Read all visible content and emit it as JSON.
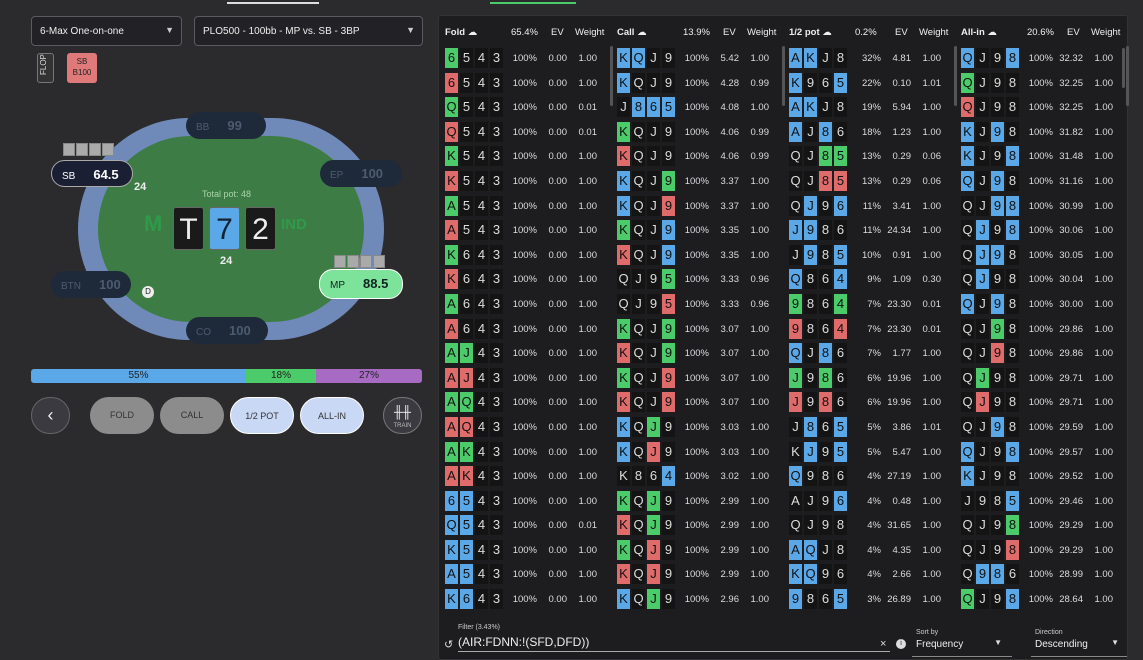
{
  "selectors": {
    "game": "6-Max One-on-one",
    "spot": "PLO500 - 100bb - MP vs. SB - 3BP"
  },
  "street": "FLOP",
  "history": {
    "line1": "SB",
    "line2": "B100"
  },
  "table": {
    "total_pot": "Total pot: 48",
    "board": [
      "T",
      "7",
      "2"
    ],
    "bet_sb": "24",
    "bet_mp": "24",
    "dealer": "D",
    "logo": "IND",
    "seats": [
      {
        "name": "BB",
        "stack": "99"
      },
      {
        "name": "SB",
        "stack": "64.5"
      },
      {
        "name": "EP",
        "stack": "100"
      },
      {
        "name": "BTN",
        "stack": "100"
      },
      {
        "name": "MP",
        "stack": "88.5"
      },
      {
        "name": "CO",
        "stack": "100"
      }
    ]
  },
  "strategy_bar": [
    {
      "label": "55%",
      "fraction": 0.55,
      "color": "#5aa8e8"
    },
    {
      "label": "18%",
      "fraction": 0.18,
      "color": "#4ccb6a"
    },
    {
      "label": "27%",
      "fraction": 0.27,
      "color": "#a76bc4"
    }
  ],
  "actions": {
    "back": "‹",
    "fold": "FOLD",
    "call": "CALL",
    "half": "1/2 POT",
    "allin": "ALL-IN",
    "train": "TRAIN"
  },
  "columns": [
    {
      "title": "Fold",
      "freq": "65.4%",
      "ev": "EV",
      "weight": "Weight",
      "rows": [
        [
          "g6 k5 k4 k3",
          "100%",
          "0.00",
          "1.00"
        ],
        [
          "r6 k5 k4 k3",
          "100%",
          "0.00",
          "1.00"
        ],
        [
          "gQ k5 k4 k3",
          "100%",
          "0.00",
          "0.01"
        ],
        [
          "rQ k5 k4 k3",
          "100%",
          "0.00",
          "0.01"
        ],
        [
          "gK k5 k4 k3",
          "100%",
          "0.00",
          "1.00"
        ],
        [
          "rK k5 k4 k3",
          "100%",
          "0.00",
          "1.00"
        ],
        [
          "gA k5 k4 k3",
          "100%",
          "0.00",
          "1.00"
        ],
        [
          "rA k5 k4 k3",
          "100%",
          "0.00",
          "1.00"
        ],
        [
          "gK k6 k4 k3",
          "100%",
          "0.00",
          "1.00"
        ],
        [
          "rK k6 k4 k3",
          "100%",
          "0.00",
          "1.00"
        ],
        [
          "gA k6 k4 k3",
          "100%",
          "0.00",
          "1.00"
        ],
        [
          "rA k6 k4 k3",
          "100%",
          "0.00",
          "1.00"
        ],
        [
          "gA gJ k4 k3",
          "100%",
          "0.00",
          "1.00"
        ],
        [
          "rA rJ k4 k3",
          "100%",
          "0.00",
          "1.00"
        ],
        [
          "gA gQ k4 k3",
          "100%",
          "0.00",
          "1.00"
        ],
        [
          "rA rQ k4 k3",
          "100%",
          "0.00",
          "1.00"
        ],
        [
          "gA gK k4 k3",
          "100%",
          "0.00",
          "1.00"
        ],
        [
          "rA rK k4 k3",
          "100%",
          "0.00",
          "1.00"
        ],
        [
          "b6 b5 k4 k3",
          "100%",
          "0.00",
          "1.00"
        ],
        [
          "bQ b5 k4 k3",
          "100%",
          "0.00",
          "0.01"
        ],
        [
          "bK b5 k4 k3",
          "100%",
          "0.00",
          "1.00"
        ],
        [
          "bA b5 k4 k3",
          "100%",
          "0.00",
          "1.00"
        ],
        [
          "bK b6 k4 k3",
          "100%",
          "0.00",
          "1.00"
        ]
      ]
    },
    {
      "title": "Call",
      "freq": "13.9%",
      "ev": "EV",
      "weight": "Weight",
      "rows": [
        [
          "bK bQ kJ k9",
          "100%",
          "5.42",
          "1.00"
        ],
        [
          "bK kQ kJ k9",
          "100%",
          "4.28",
          "0.99"
        ],
        [
          "kJ b8 b6 b5",
          "100%",
          "4.08",
          "1.00"
        ],
        [
          "gK kQ kJ k9",
          "100%",
          "4.06",
          "0.99"
        ],
        [
          "rK kQ kJ k9",
          "100%",
          "4.06",
          "0.99"
        ],
        [
          "bK kQ kJ g9",
          "100%",
          "3.37",
          "1.00"
        ],
        [
          "bK kQ kJ r9",
          "100%",
          "3.37",
          "1.00"
        ],
        [
          "gK kQ kJ b9",
          "100%",
          "3.35",
          "1.00"
        ],
        [
          "rK kQ kJ b9",
          "100%",
          "3.35",
          "1.00"
        ],
        [
          "kQ kJ k9 g5",
          "100%",
          "3.33",
          "0.96"
        ],
        [
          "kQ kJ k9 r5",
          "100%",
          "3.33",
          "0.96"
        ],
        [
          "gK kQ kJ g9",
          "100%",
          "3.07",
          "1.00"
        ],
        [
          "rK kQ kJ g9",
          "100%",
          "3.07",
          "1.00"
        ],
        [
          "gK kQ kJ r9",
          "100%",
          "3.07",
          "1.00"
        ],
        [
          "rK kQ kJ r9",
          "100%",
          "3.07",
          "1.00"
        ],
        [
          "bK kQ gJ k9",
          "100%",
          "3.03",
          "1.00"
        ],
        [
          "bK kQ rJ k9",
          "100%",
          "3.03",
          "1.00"
        ],
        [
          "kK k8 k6 b4",
          "100%",
          "3.02",
          "1.00"
        ],
        [
          "gK kQ gJ k9",
          "100%",
          "2.99",
          "1.00"
        ],
        [
          "rK kQ gJ k9",
          "100%",
          "2.99",
          "1.00"
        ],
        [
          "gK kQ rJ k9",
          "100%",
          "2.99",
          "1.00"
        ],
        [
          "rK kQ rJ k9",
          "100%",
          "2.99",
          "1.00"
        ],
        [
          "bK kQ gJ k9",
          "100%",
          "2.96",
          "1.00"
        ]
      ]
    },
    {
      "title": "1/2 pot",
      "freq": "0.2%",
      "ev": "EV",
      "weight": "Weight",
      "rows": [
        [
          "bA bK kJ k8",
          "32%",
          "4.81",
          "1.00"
        ],
        [
          "bK k9 k6 b5",
          "22%",
          "0.10",
          "1.01"
        ],
        [
          "bA bK kJ k8",
          "19%",
          "5.94",
          "1.00"
        ],
        [
          "bA kJ b8 k6",
          "18%",
          "1.23",
          "1.00"
        ],
        [
          "kQ kJ g8 g5",
          "13%",
          "0.29",
          "0.06"
        ],
        [
          "kQ kJ r8 r5",
          "13%",
          "0.29",
          "0.06"
        ],
        [
          "kQ bJ k9 b6",
          "11%",
          "3.41",
          "1.00"
        ],
        [
          "bJ b9 k8 k6",
          "11%",
          "24.34",
          "1.00"
        ],
        [
          "kJ b9 k8 b5",
          "10%",
          "0.91",
          "1.00"
        ],
        [
          "bQ k8 k6 b4",
          "9%",
          "1.09",
          "0.30"
        ],
        [
          "g9 k8 k6 g4",
          "7%",
          "23.30",
          "0.01"
        ],
        [
          "r9 k8 k6 r4",
          "7%",
          "23.30",
          "0.01"
        ],
        [
          "bQ kJ b8 k6",
          "7%",
          "1.77",
          "1.00"
        ],
        [
          "gJ k9 g8 k6",
          "6%",
          "19.96",
          "1.00"
        ],
        [
          "rJ k9 r8 k6",
          "6%",
          "19.96",
          "1.00"
        ],
        [
          "kJ b8 k6 b5",
          "5%",
          "3.86",
          "1.01"
        ],
        [
          "kK bJ k9 b5",
          "5%",
          "5.47",
          "1.00"
        ],
        [
          "bQ k9 k8 k6",
          "4%",
          "27.19",
          "1.00"
        ],
        [
          "kA kJ k9 b6",
          "4%",
          "0.48",
          "1.00"
        ],
        [
          "kQ kJ k9 k8",
          "4%",
          "31.65",
          "1.00"
        ],
        [
          "bA bQ kJ k8",
          "4%",
          "4.35",
          "1.00"
        ],
        [
          "bK bQ k9 k6",
          "4%",
          "2.66",
          "1.00"
        ],
        [
          "b9 k8 k6 b5",
          "3%",
          "26.89",
          "1.00"
        ]
      ]
    },
    {
      "title": "All-in",
      "freq": "20.6%",
      "ev": "EV",
      "weight": "Weight",
      "rows": [
        [
          "bQ kJ k9 b8",
          "100%",
          "32.32",
          "1.00"
        ],
        [
          "gQ kJ k9 k8",
          "100%",
          "32.25",
          "1.00"
        ],
        [
          "rQ kJ k9 k8",
          "100%",
          "32.25",
          "1.00"
        ],
        [
          "bK kJ b9 k8",
          "100%",
          "31.82",
          "1.00"
        ],
        [
          "bK kJ k9 b8",
          "100%",
          "31.48",
          "1.00"
        ],
        [
          "bQ kJ b9 k8",
          "100%",
          "31.16",
          "1.00"
        ],
        [
          "kQ kJ b9 b8",
          "100%",
          "30.99",
          "1.00"
        ],
        [
          "kQ bJ k9 b8",
          "100%",
          "30.06",
          "1.00"
        ],
        [
          "kQ bJ b9 k8",
          "100%",
          "30.05",
          "1.00"
        ],
        [
          "kQ bJ k9 k8",
          "100%",
          "30.04",
          "1.00"
        ],
        [
          "bQ kJ b9 k8",
          "100%",
          "30.00",
          "1.00"
        ],
        [
          "kQ kJ g9 k8",
          "100%",
          "29.86",
          "1.00"
        ],
        [
          "kQ kJ r9 k8",
          "100%",
          "29.86",
          "1.00"
        ],
        [
          "kQ gJ k9 k8",
          "100%",
          "29.71",
          "1.00"
        ],
        [
          "kQ rJ k9 k8",
          "100%",
          "29.71",
          "1.00"
        ],
        [
          "kQ kJ b9 k8",
          "100%",
          "29.59",
          "1.00"
        ],
        [
          "bQ kJ k9 b8",
          "100%",
          "29.57",
          "1.00"
        ],
        [
          "bK kJ k9 k8",
          "100%",
          "29.52",
          "1.00"
        ],
        [
          "kJ k9 k8 b5",
          "100%",
          "29.46",
          "1.00"
        ],
        [
          "kQ kJ k9 g8",
          "100%",
          "29.29",
          "1.00"
        ],
        [
          "kQ kJ k9 r8",
          "100%",
          "29.29",
          "1.00"
        ],
        [
          "kQ b9 b8 k6",
          "100%",
          "28.99",
          "1.00"
        ],
        [
          "gQ kJ k9 b8",
          "100%",
          "28.64",
          "1.00"
        ]
      ]
    }
  ],
  "filter": {
    "label": "Filter (3.43%)",
    "value": "(AIR:FDNN:!(SFD,DFD))"
  },
  "sort": {
    "label": "Sort by",
    "value": "Frequency"
  },
  "direction": {
    "label": "Direction",
    "value": "Descending"
  }
}
